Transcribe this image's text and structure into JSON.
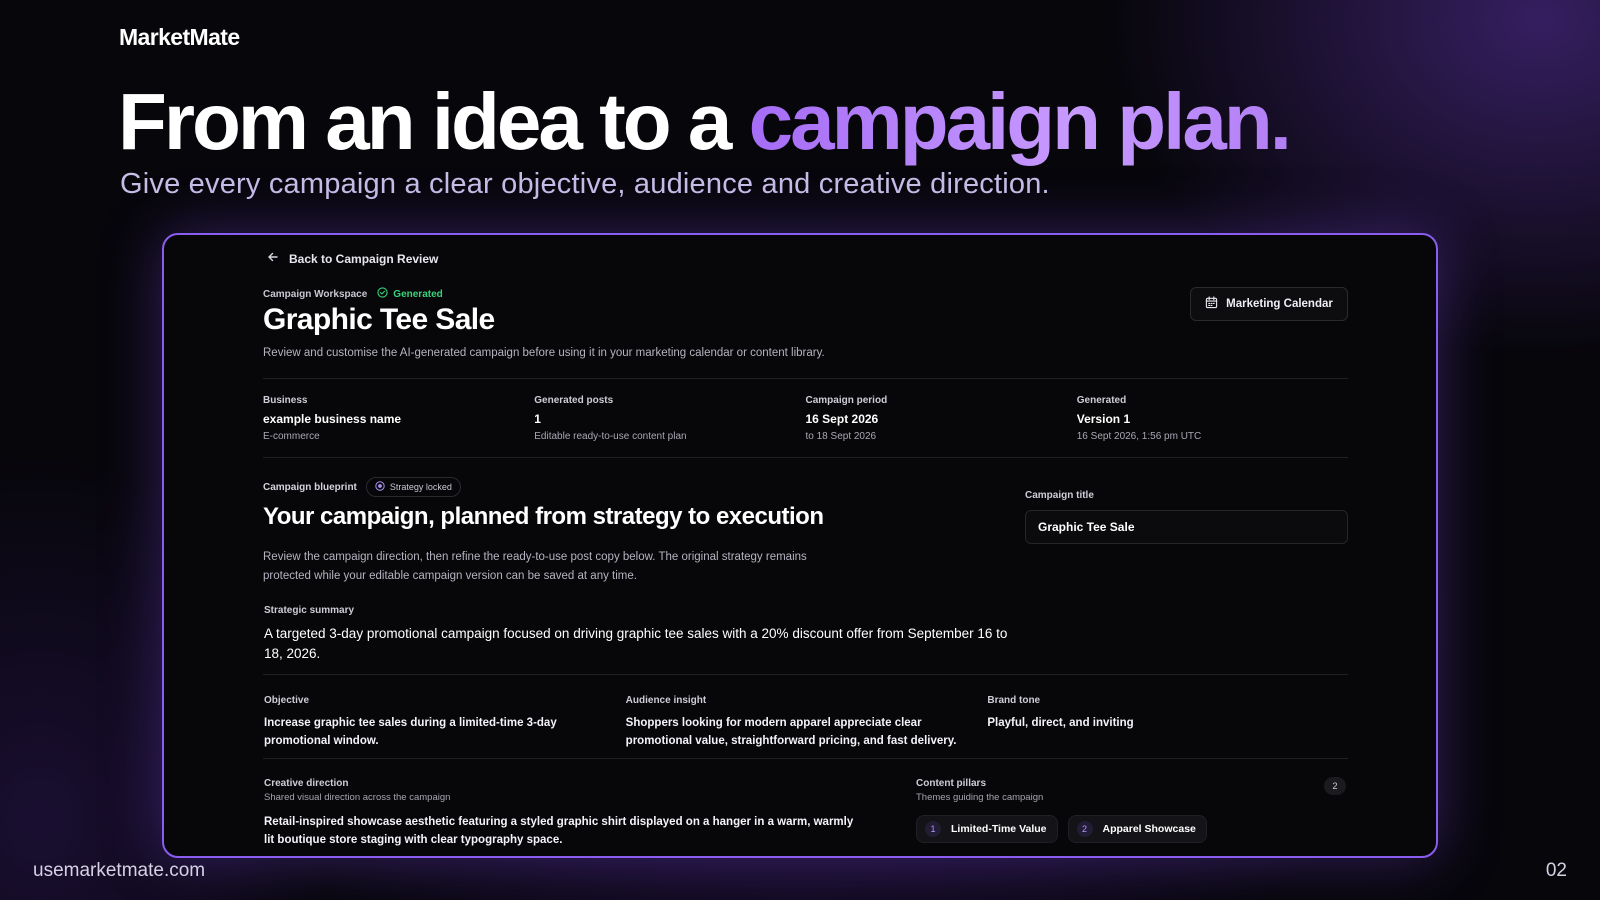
{
  "slide": {
    "brand": "MarketMate",
    "headline_plain": "From an idea to a ",
    "headline_accent": "campaign plan.",
    "subheadline": "Give every campaign a clear objective, audience and creative direction.",
    "footer_url": "usemarketmate.com",
    "page_number": "02"
  },
  "workspace": {
    "back_label": "Back to Campaign Review",
    "eyebrow": "Campaign Workspace",
    "status": "Generated",
    "title": "Graphic Tee Sale",
    "description": "Review and customise the AI-generated campaign before using it in your marketing calendar or content library.",
    "calendar_button": "Marketing Calendar"
  },
  "stats": [
    {
      "label": "Business",
      "value": "example business name",
      "sub": "E-commerce"
    },
    {
      "label": "Generated posts",
      "value": "1",
      "sub": "Editable ready-to-use content plan"
    },
    {
      "label": "Campaign period",
      "value": "16 Sept 2026",
      "sub": "to 18 Sept 2026"
    },
    {
      "label": "Generated",
      "value": "Version 1",
      "sub": "16 Sept 2026, 1:56 pm UTC"
    }
  ],
  "blueprint": {
    "label": "Campaign blueprint",
    "lock_badge": "Strategy locked",
    "title": "Your campaign, planned from strategy to execution",
    "description": "Review the campaign direction, then refine the ready-to-use post copy below. The original strategy remains protected while your editable campaign version can be saved at any time.",
    "campaign_title_label": "Campaign title",
    "campaign_title_value": "Graphic Tee Sale",
    "summary_label": "Strategic summary",
    "summary_text": "A targeted 3-day promotional campaign focused on driving graphic tee sales with a 20% discount offer from September 16 to 18, 2026."
  },
  "insights": [
    {
      "label": "Objective",
      "text": "Increase graphic tee sales during a limited-time 3-day promotional window."
    },
    {
      "label": "Audience insight",
      "text": "Shoppers looking for modern apparel appreciate clear promotional value, straightforward pricing, and fast delivery."
    },
    {
      "label": "Brand tone",
      "text": "Playful, direct, and inviting"
    }
  ],
  "creative": {
    "label": "Creative direction",
    "sub": "Shared visual direction across the campaign",
    "text": "Retail-inspired showcase aesthetic featuring a styled graphic shirt displayed on a hanger in a warm, warmly lit boutique store staging with clear typography space."
  },
  "pillars": {
    "label": "Content pillars",
    "sub": "Themes guiding the campaign",
    "count": "2",
    "items": [
      {
        "num": "1",
        "label": "Limited-Time Value"
      },
      {
        "num": "2",
        "label": "Apparel Showcase"
      }
    ]
  },
  "colors": {
    "accent": "#a56cf5",
    "status_green": "#37d27a",
    "frame_border": "#8a5cf0"
  },
  "icons": [
    "arrow-left-icon",
    "check-circle-icon",
    "calendar-icon",
    "lock-circle-icon"
  ]
}
